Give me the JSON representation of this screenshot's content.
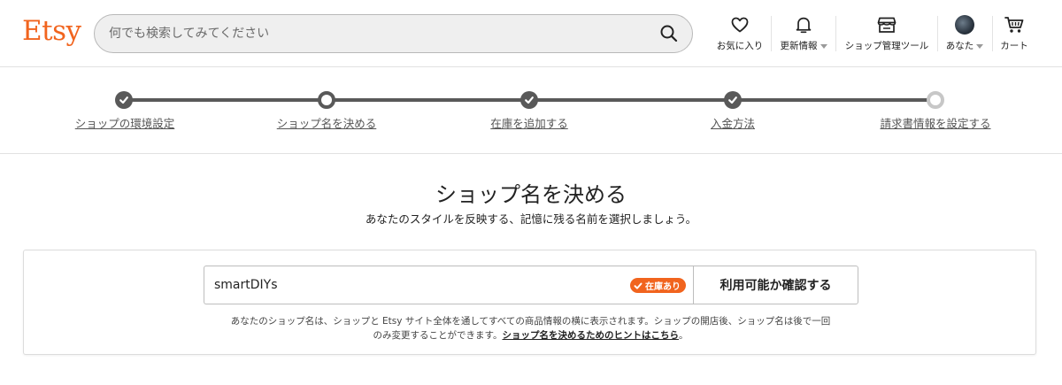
{
  "header": {
    "logo": "Etsy",
    "search": {
      "placeholder": "何でも検索してみてください",
      "value": ""
    },
    "nav": {
      "favorites": "お気に入り",
      "updates": "更新情報",
      "shop_manager": "ショップ管理ツール",
      "you": "あなた",
      "cart": "カート"
    }
  },
  "steps": [
    {
      "label": "ショップの環境設定",
      "state": "done"
    },
    {
      "label": "ショップ名を決める",
      "state": "current"
    },
    {
      "label": "在庫を追加する",
      "state": "done"
    },
    {
      "label": "入金方法",
      "state": "done"
    },
    {
      "label": "請求書情報を設定する",
      "state": "todo"
    }
  ],
  "main": {
    "title": "ショップ名を決める",
    "subtitle": "あなたのスタイルを反映する、記憶に残る名前を選択しましょう。",
    "shop_name_value": "smartDIYs",
    "availability_badge": "在庫あり",
    "check_button": "利用可能か確認する",
    "help_text_1": "あなたのショップ名は、ショップと Etsy サイト全体を通してすべての商品情報の横に表示されます。ショップの開店後、ショップ名は後で一回",
    "help_text_2": "のみ変更することができます。",
    "help_link": "ショップ名を決めるためのヒントはこちら",
    "help_text_end": "。"
  },
  "colors": {
    "brand": "#f1641e",
    "step_done": "#595959",
    "step_todo": "#c7c7c7"
  }
}
